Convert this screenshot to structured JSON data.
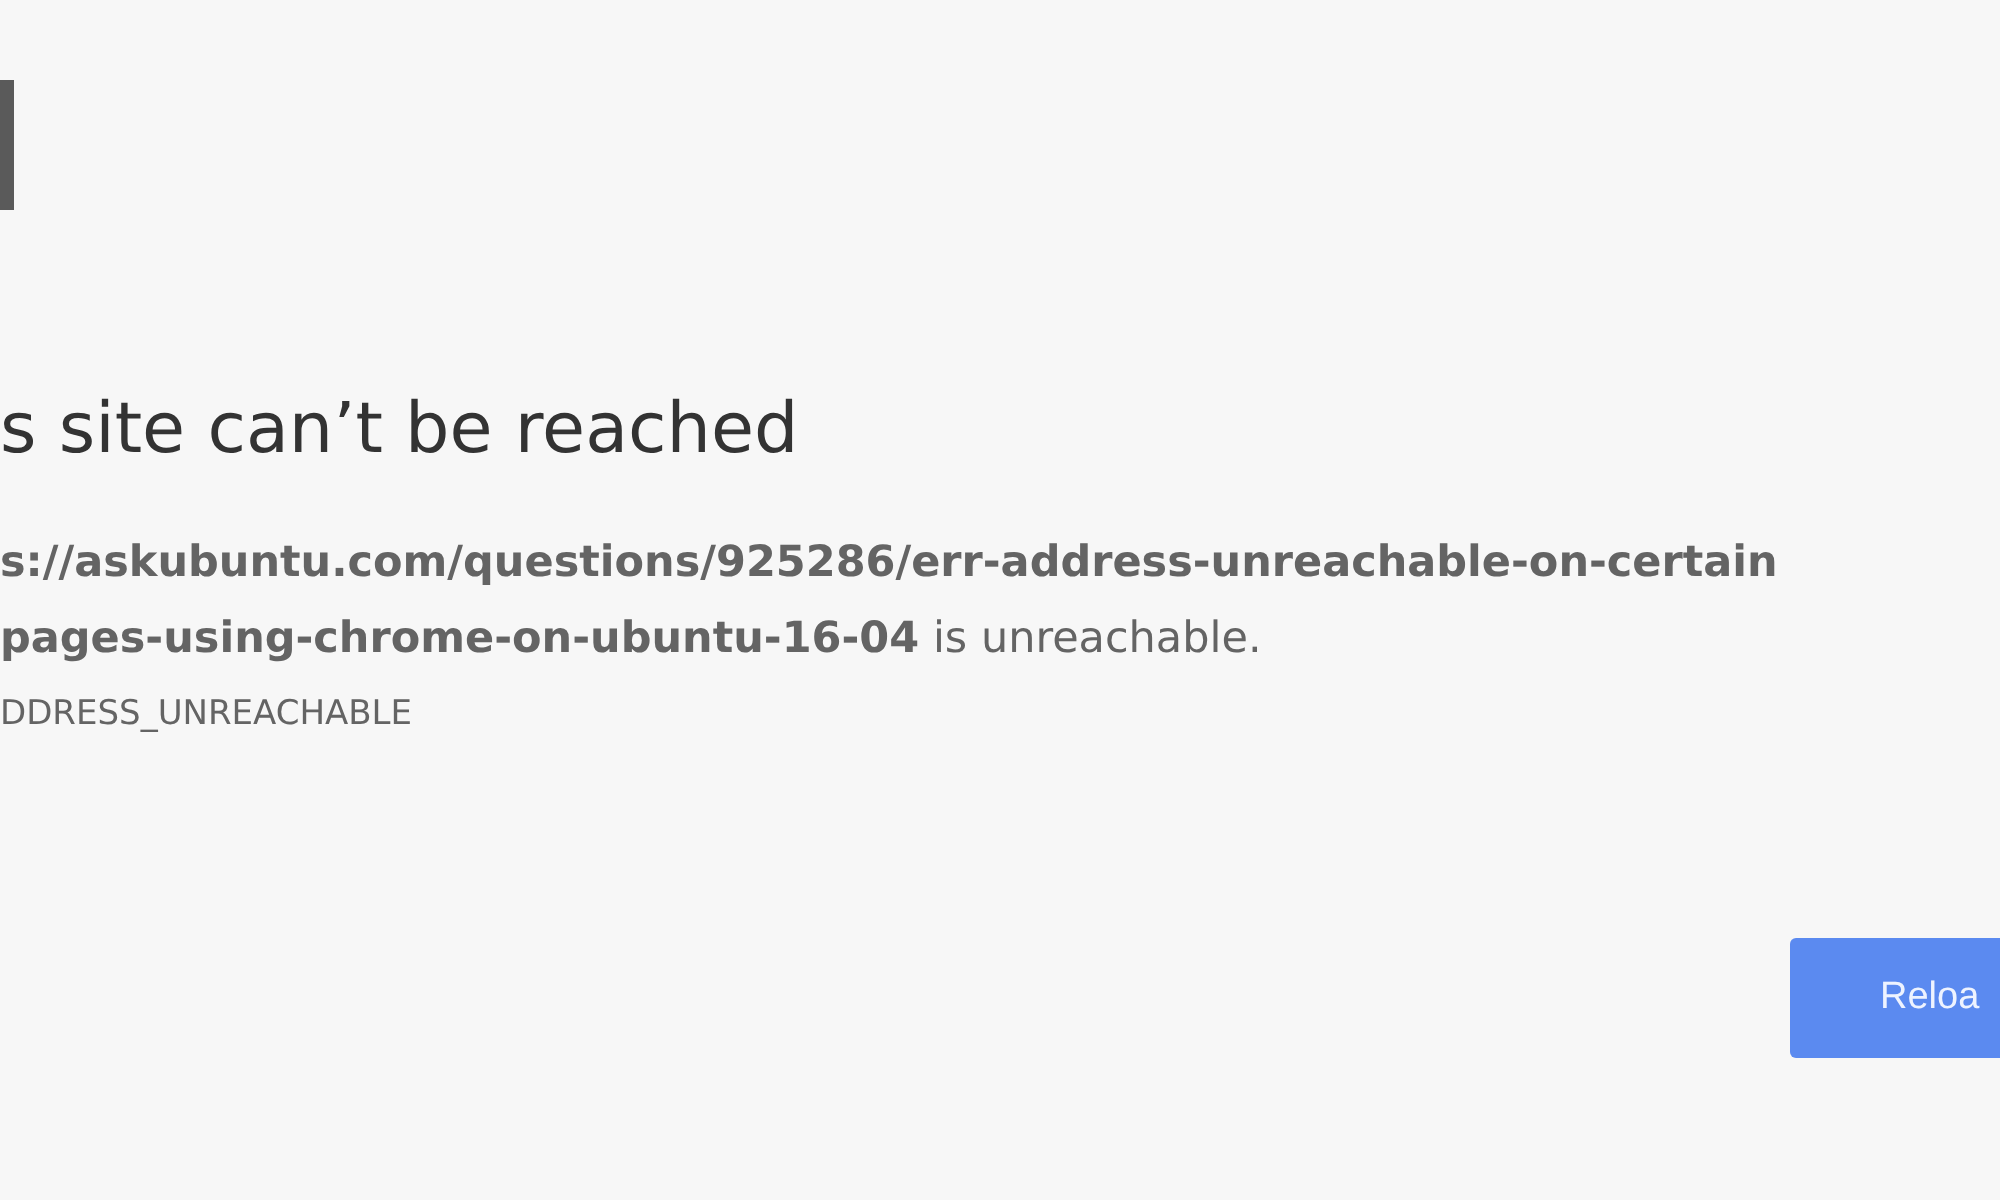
{
  "heading": "s site can’t be reached",
  "message_lines": [
    "**s://askubuntu.com/questions/925286/err-address-unreachable-on-certain**",
    "**pages-using-chrome-on-ubuntu-16-04** is unreachable."
  ],
  "error_code": "DDRESS_UNREACHABLE",
  "button": {
    "label": "Reloa"
  }
}
